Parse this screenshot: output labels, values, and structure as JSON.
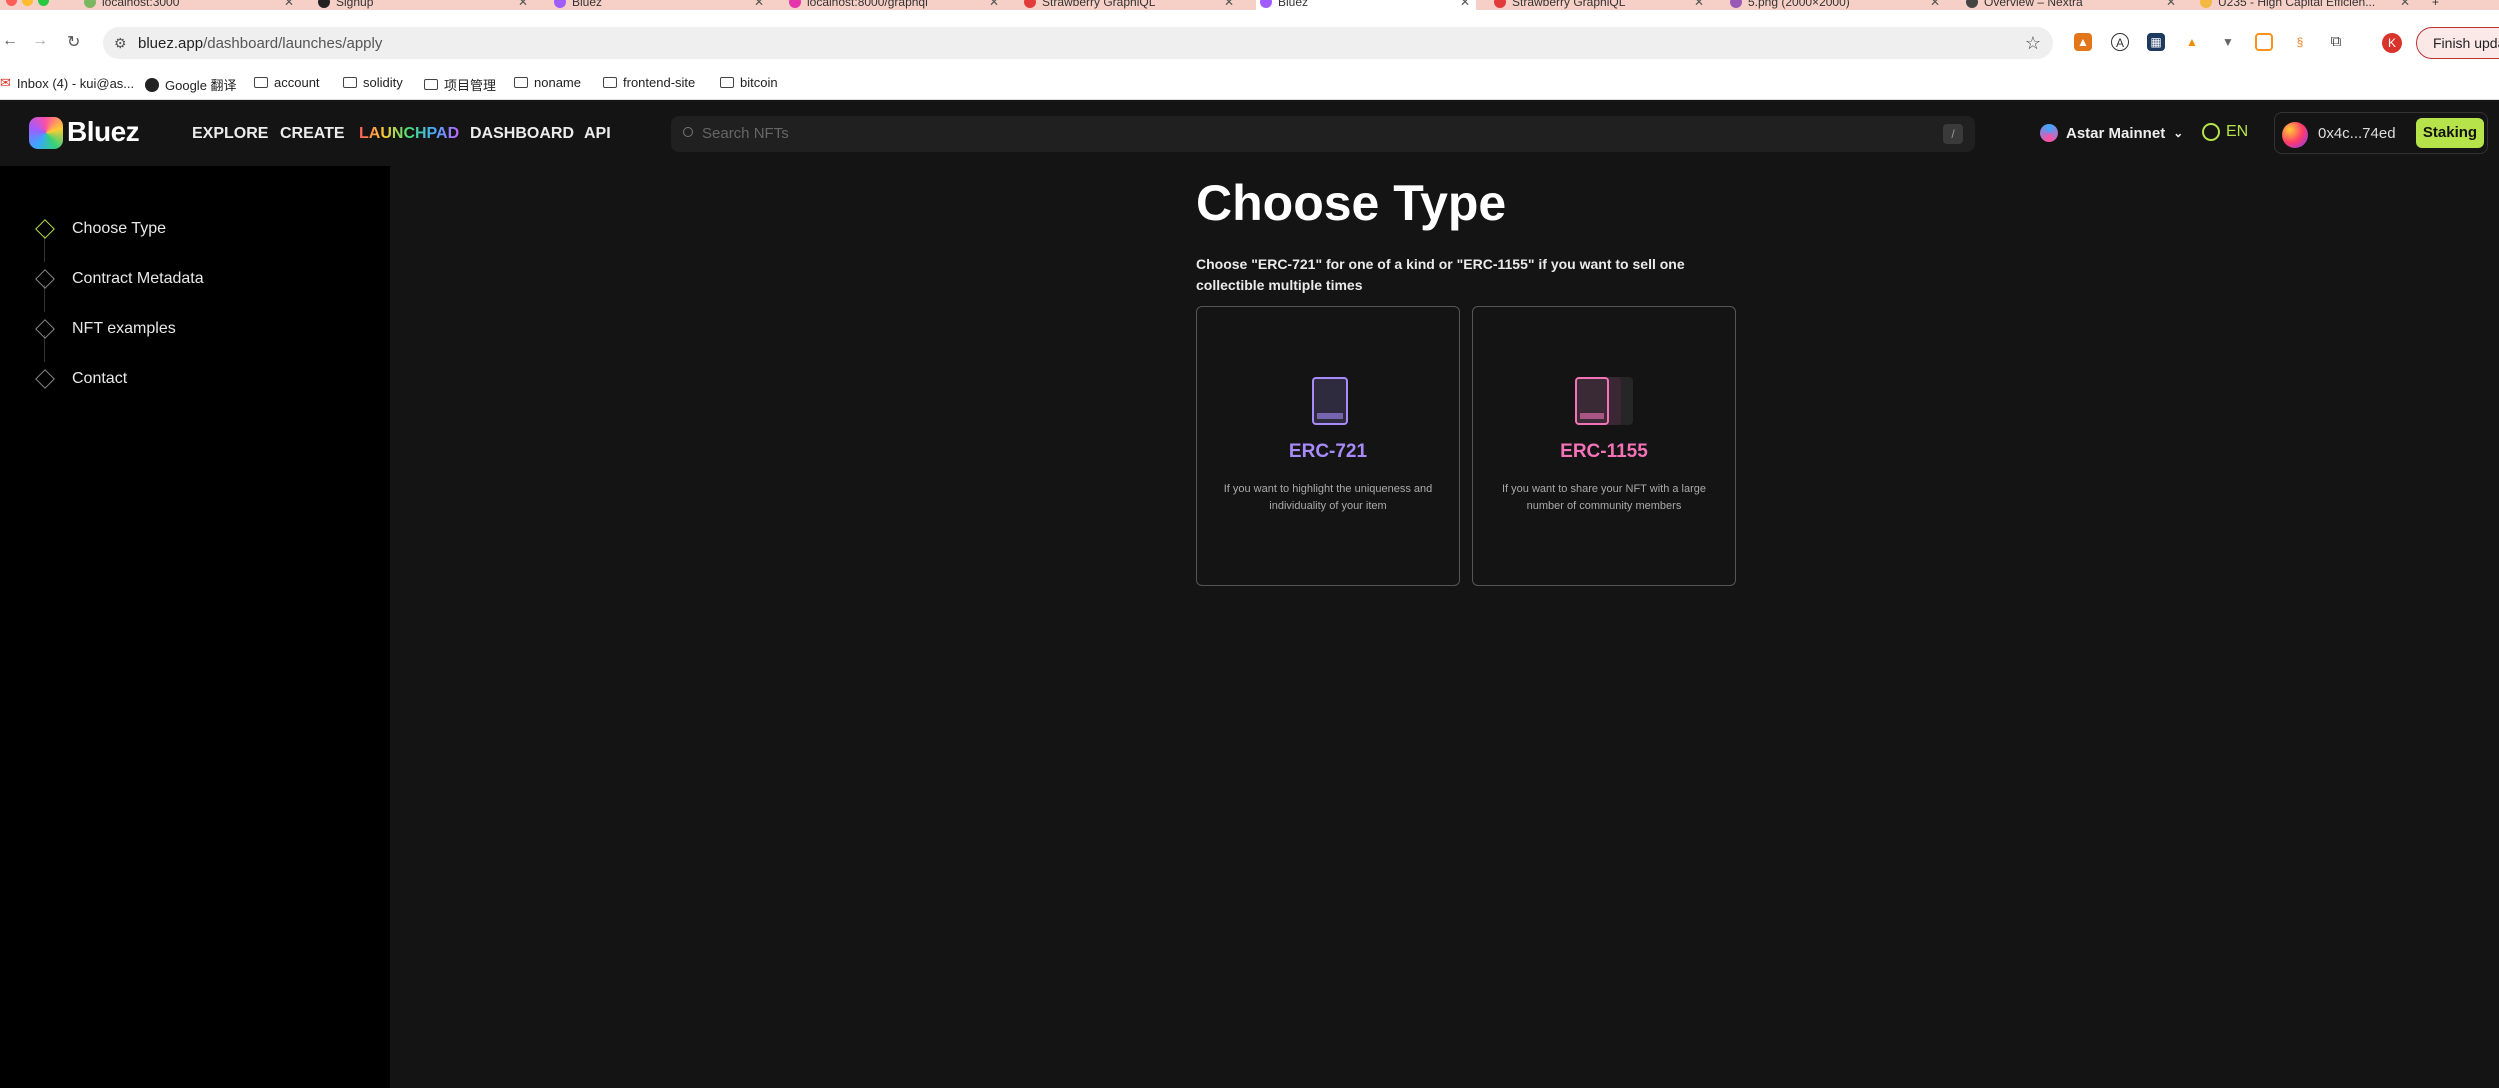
{
  "browser": {
    "tabs": [
      {
        "label": "localhost:3000",
        "favicon": "#7bb661"
      },
      {
        "label": "Signup",
        "favicon": "#222222"
      },
      {
        "label": "Bluez",
        "favicon": "#a05cff"
      },
      {
        "label": "localhost:8000/graphql",
        "favicon": "#e535ab"
      },
      {
        "label": "Strawberry GraphiQL",
        "favicon": "#e23b3b"
      },
      {
        "label": "Bluez",
        "favicon": "#a05cff",
        "active": true
      },
      {
        "label": "Strawberry GraphiQL",
        "favicon": "#e23b3b"
      },
      {
        "label": "5.png (2000×2000)",
        "favicon": "#9b59b6"
      },
      {
        "label": "Overview – Nextra",
        "favicon": "#444444"
      },
      {
        "label": "U235 - High Capital Efficien...",
        "favicon": "#f4b942"
      }
    ],
    "new_tab": "+",
    "url_host": "bluez.app",
    "url_path": "/dashboard/launches/apply",
    "update_button": "Finish update",
    "profile_initial": "K",
    "bookmarks": [
      {
        "label": "Inbox (4) - kui@as...",
        "type": "mail"
      },
      {
        "label": "Google 翻译",
        "type": "site"
      },
      {
        "label": "account",
        "type": "folder"
      },
      {
        "label": "solidity",
        "type": "folder"
      },
      {
        "label": "项目管理",
        "type": "folder"
      },
      {
        "label": "noname",
        "type": "folder"
      },
      {
        "label": "frontend-site",
        "type": "folder"
      },
      {
        "label": "bitcoin",
        "type": "folder"
      }
    ]
  },
  "site": {
    "logo_text": "Bluez",
    "nav": [
      "EXPLORE",
      "CREATE",
      "LAUNCHPAD",
      "DASHBOARD",
      "API"
    ],
    "search_placeholder": "Search NFTs",
    "search_shortcut": "/",
    "network": "Astar Mainnet",
    "language": "EN",
    "wallet_address": "0x4c...74ed",
    "staking_label": "Staking",
    "accent": "#b6e34a"
  },
  "sidebar": {
    "steps": [
      {
        "label": "Choose Type",
        "active": true
      },
      {
        "label": "Contract Metadata",
        "active": false
      },
      {
        "label": "NFT examples",
        "active": false
      },
      {
        "label": "Contact",
        "active": false
      }
    ]
  },
  "main": {
    "title": "Choose Type",
    "description": "Choose \"ERC-721\" for one of a kind or \"ERC-1155\" if you want to sell one collectible multiple times",
    "cards": [
      {
        "title": "ERC-721",
        "description": "If you want to highlight the uniqueness and individuality of your item",
        "color": "#a78bfa"
      },
      {
        "title": "ERC-1155",
        "description": "If you want to share your NFT with a large number of community members",
        "color": "#f472b6"
      }
    ]
  }
}
